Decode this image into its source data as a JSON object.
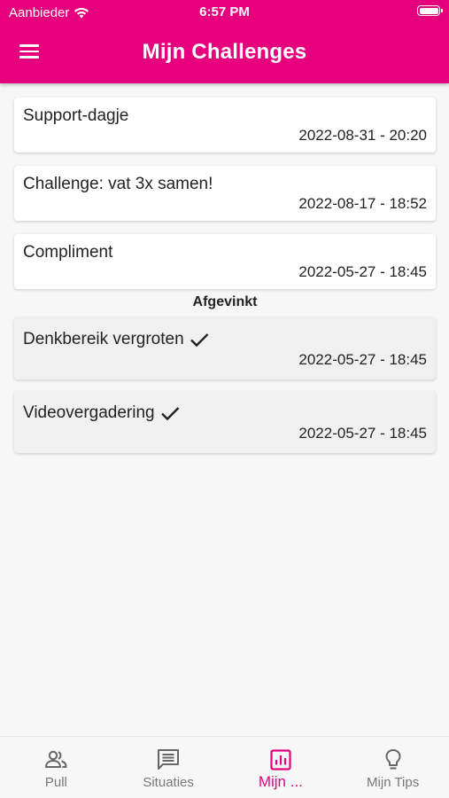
{
  "status_bar": {
    "carrier": "Aanbieder",
    "time": "6:57 PM"
  },
  "header": {
    "title": "Mijn Challenges",
    "background_color": "#e6007e"
  },
  "challenges": [
    {
      "title": "Support-dagje",
      "date": "2022-08-31 - 20:20"
    },
    {
      "title": "Challenge: vat 3x samen!",
      "date": "2022-08-17 - 18:52"
    },
    {
      "title": "Compliment",
      "date": "2022-05-27 - 18:45"
    }
  ],
  "completed_section": {
    "heading": "Afgevinkt",
    "items": [
      {
        "title": "Denkbereik vergroten",
        "date": "2022-05-27 - 18:45",
        "checked": true
      },
      {
        "title": "Videovergadering",
        "date": "2022-05-27 - 18:45",
        "checked": true
      }
    ]
  },
  "tabs": [
    {
      "label": "Pull",
      "icon": "people-icon",
      "active": false
    },
    {
      "label": "Situaties",
      "icon": "message-icon",
      "active": false
    },
    {
      "label": "Mijn ...",
      "icon": "chart-icon",
      "active": true
    },
    {
      "label": "Mijn Tips",
      "icon": "lightbulb-icon",
      "active": false
    }
  ],
  "colors": {
    "accent": "#e6007e",
    "inactive_tab": "#777777"
  }
}
